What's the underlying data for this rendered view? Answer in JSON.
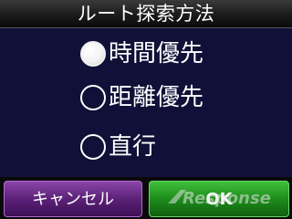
{
  "title": "ルート探索方法",
  "options": [
    {
      "label": "時間優先",
      "selected": true
    },
    {
      "label": "距離優先",
      "selected": false
    },
    {
      "label": "直行",
      "selected": false
    }
  ],
  "buttons": {
    "cancel_label": "キャンセル",
    "ok_label": "OK"
  },
  "watermark": {
    "text": "Response."
  },
  "colors": {
    "options_background": "#101038",
    "cancel_button": "#5c2278",
    "ok_button": "#1e8c1c"
  }
}
